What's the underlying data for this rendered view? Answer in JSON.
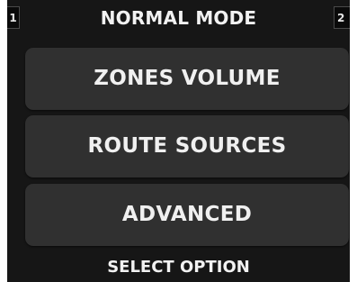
{
  "header": {
    "title": "NORMAL MODE",
    "page_left": "1",
    "page_right": "2"
  },
  "menu": {
    "items": [
      {
        "label": "ZONES VOLUME"
      },
      {
        "label": "ROUTE SOURCES"
      },
      {
        "label": "ADVANCED"
      }
    ]
  },
  "footer": {
    "status": "SELECT OPTION"
  },
  "colors": {
    "screen_bg": "#161616",
    "button_bg": "#303030",
    "text": "#f0f0f0",
    "badge_bg": "#0a0a0a"
  }
}
